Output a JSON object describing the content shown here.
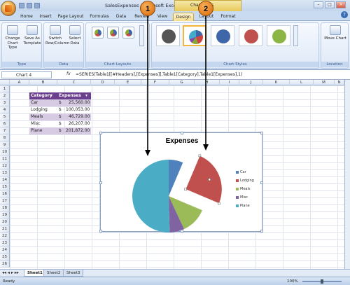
{
  "window": {
    "title": "SalesExpenses - Microsoft Excel",
    "context_tab": "Chart Tools",
    "controls": [
      "–",
      "□",
      "×"
    ]
  },
  "tabs": [
    "Home",
    "Insert",
    "Page Layout",
    "Formulas",
    "Data",
    "Review",
    "View",
    "Design",
    "Layout",
    "Format"
  ],
  "active_tab": "Design",
  "ribbon": {
    "groups": [
      {
        "name": "Type",
        "buttons": [
          "Change Chart Type",
          "Save As Template"
        ]
      },
      {
        "name": "Data",
        "buttons": [
          "Switch Row/Column",
          "Select Data"
        ]
      },
      {
        "name": "Chart Layouts"
      },
      {
        "name": "Chart Styles"
      },
      {
        "name": "Location",
        "buttons": [
          "Move Chart"
        ]
      }
    ],
    "style_colors": [
      "#555555",
      "#3f66a8",
      "#3f66a8",
      "#c0504d",
      "#8bb545"
    ]
  },
  "formula_bar": {
    "name_box": "Chart 4",
    "fx": "fx",
    "formula": "=SERIES(Table1[[#Headers],[Expenses]],Table1[Category],Table1[Expenses],1)"
  },
  "columns": [
    "A",
    "B",
    "C",
    "D",
    "E",
    "F",
    "G",
    "H",
    "I",
    "J",
    "K",
    "L",
    "M",
    "N"
  ],
  "rows": [
    "1",
    "2",
    "3",
    "4",
    "5",
    "6",
    "7",
    "8",
    "9",
    "10",
    "11",
    "12",
    "13",
    "14",
    "15",
    "16",
    "17",
    "18",
    "19",
    "20",
    "21",
    "22",
    "23",
    "24",
    "25",
    "26"
  ],
  "table": {
    "headers": [
      "Category",
      "Expenses"
    ],
    "rows": [
      {
        "category": "Car",
        "currency": "$",
        "amount": "25,560.00"
      },
      {
        "category": "Lodging",
        "currency": "$",
        "amount": "100,053.00"
      },
      {
        "category": "Meals",
        "currency": "$",
        "amount": "46,729.00"
      },
      {
        "category": "Misc",
        "currency": "$",
        "amount": "26,207.00"
      },
      {
        "category": "Plane",
        "currency": "$",
        "amount": "201,872.00"
      }
    ]
  },
  "chart_data": {
    "type": "pie",
    "title": "Expenses",
    "categories": [
      "Car",
      "Lodging",
      "Meals",
      "Misc",
      "Plane"
    ],
    "values": [
      25560,
      100053,
      46729,
      26207,
      201872
    ],
    "colors": [
      "#4f81bd",
      "#c0504d",
      "#9bbb59",
      "#8064a2",
      "#4bacc6"
    ],
    "exploded": "Lodging",
    "legend": "right"
  },
  "callouts": [
    "1",
    "2"
  ],
  "sheets": [
    "Sheet1",
    "Sheet2",
    "Sheet3"
  ],
  "status": {
    "text": "Ready",
    "zoom": "100%"
  }
}
